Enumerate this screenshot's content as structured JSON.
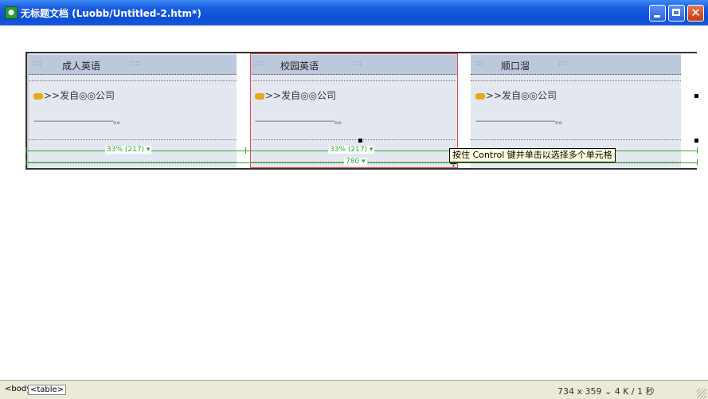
{
  "window": {
    "title": "无标题文档 (Luobb/Untitled-2.htm*)",
    "app_icon": "dreamweaver-icon"
  },
  "table": {
    "columns": [
      {
        "header": "成人英语",
        "item": ">>发自◎◎公司",
        "dashes": "——————————。。"
      },
      {
        "header": "校园英语",
        "item": ">>发自◎◎公司",
        "dashes": "——————————。。"
      },
      {
        "header": "顺口溜",
        "item": ">>发自◎◎公司",
        "dashes": "——————————。。"
      }
    ],
    "header_dots": ":::: ",
    "header_dots_right": "::::"
  },
  "measures": {
    "col1_label": "33% (217) ▾",
    "col2_label": "33% (217) ▾",
    "total_label": "780 ▾"
  },
  "tooltip": "按住 Control 键并单击以选择多个单元格",
  "statusbar": {
    "tag_body": "<body>",
    "tag_table": "<table>",
    "right": "734 x 359 ⌄ 4 K / 1 秒"
  },
  "colors": {
    "title_bar": "#0b4fd6",
    "header_bg": "#bcc8dc",
    "cell_bg": "#e3e8f0",
    "selection": "#e84a4a",
    "measure": "#2fa82f",
    "tooltip_bg": "#ffffe1"
  }
}
